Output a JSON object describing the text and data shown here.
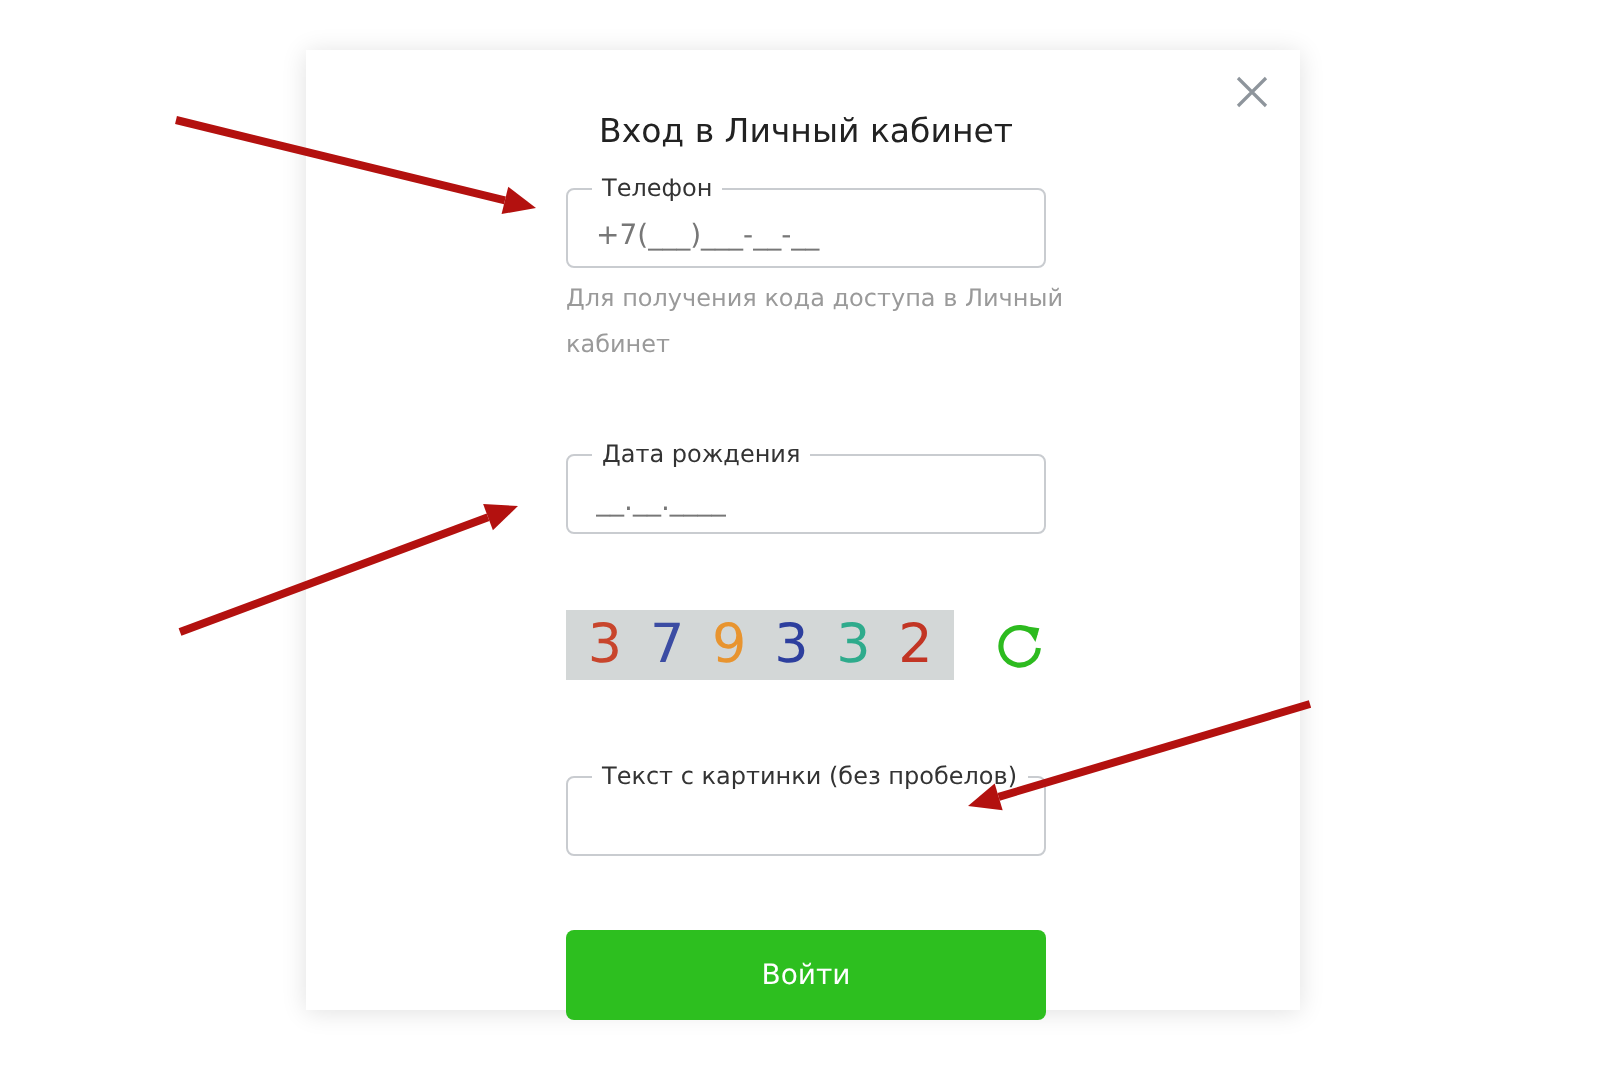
{
  "dialog": {
    "title": "Вход в Личный кабинет",
    "fields": [
      {
        "kind": "phone",
        "label": "Телефон",
        "placeholder": "+7(___)___-__-__",
        "hint": "Для получения кода доступа в Личный кабинет"
      },
      {
        "kind": "date",
        "label": "Дата рождения",
        "placeholder": "__.__.____"
      },
      {
        "kind": "captcha",
        "label": "Текст с картинки (без пробелов)"
      }
    ],
    "captcha": {
      "characters": [
        {
          "char": "3",
          "color": "#c8452c"
        },
        {
          "char": "7",
          "color": "#3b4ca3"
        },
        {
          "char": "9",
          "color": "#e8942f"
        },
        {
          "char": "3",
          "color": "#2d3f9e"
        },
        {
          "char": "3",
          "color": "#2eab8c"
        },
        {
          "char": "2",
          "color": "#c23524"
        }
      ]
    },
    "submit": "Войти"
  }
}
